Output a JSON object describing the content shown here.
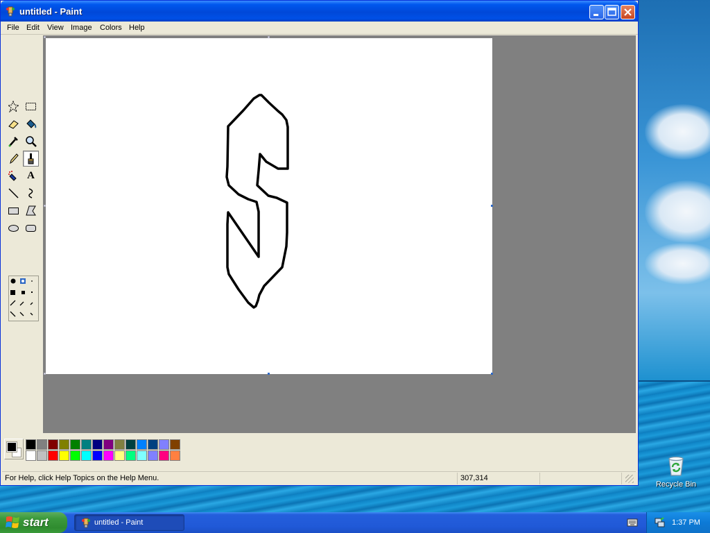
{
  "window": {
    "title": "untitled - Paint",
    "controls": [
      "minimize",
      "maximize",
      "close"
    ]
  },
  "menu": {
    "items": [
      "File",
      "Edit",
      "View",
      "Image",
      "Colors",
      "Help"
    ]
  },
  "toolbox": {
    "tools": [
      {
        "name": "free-form-select",
        "icon": "star-select-icon"
      },
      {
        "name": "select",
        "icon": "rect-select-icon"
      },
      {
        "name": "eraser",
        "icon": "eraser-icon"
      },
      {
        "name": "fill",
        "icon": "paint-bucket-icon"
      },
      {
        "name": "pick-color",
        "icon": "eyedropper-icon"
      },
      {
        "name": "magnifier",
        "icon": "magnifier-icon"
      },
      {
        "name": "pencil",
        "icon": "pencil-icon"
      },
      {
        "name": "brush",
        "icon": "brush-icon",
        "active": true
      },
      {
        "name": "airbrush",
        "icon": "airbrush-icon"
      },
      {
        "name": "text",
        "icon": "text-icon",
        "glyph": "A"
      },
      {
        "name": "line",
        "icon": "line-icon"
      },
      {
        "name": "curve",
        "icon": "curve-icon"
      },
      {
        "name": "rectangle",
        "icon": "rectangle-icon"
      },
      {
        "name": "polygon",
        "icon": "polygon-icon"
      },
      {
        "name": "ellipse",
        "icon": "ellipse-icon"
      },
      {
        "name": "rounded-rectangle",
        "icon": "rounded-rect-icon"
      }
    ]
  },
  "palette": {
    "foreground": "#000000",
    "background": "#ffffff",
    "row1": [
      "#000000",
      "#808080",
      "#800000",
      "#808000",
      "#008000",
      "#008080",
      "#000080",
      "#800080",
      "#808040",
      "#004040",
      "#0080ff",
      "#004080",
      "#8080ff",
      "#804000"
    ],
    "row2": [
      "#ffffff",
      "#c0c0c0",
      "#ff0000",
      "#ffff00",
      "#00ff00",
      "#00ffff",
      "#0000ff",
      "#ff00ff",
      "#ffff80",
      "#00ff80",
      "#80ffff",
      "#8080ff",
      "#ff0080",
      "#ff8040"
    ]
  },
  "status": {
    "help_text": "For Help, click Help Topics on the Help Menu.",
    "coords": "307,314"
  },
  "desktop": {
    "recycle_bin_label": "Recycle Bin"
  },
  "taskbar": {
    "start_label": "start",
    "task_label": "untitled - Paint",
    "clock": "1:37 PM"
  }
}
